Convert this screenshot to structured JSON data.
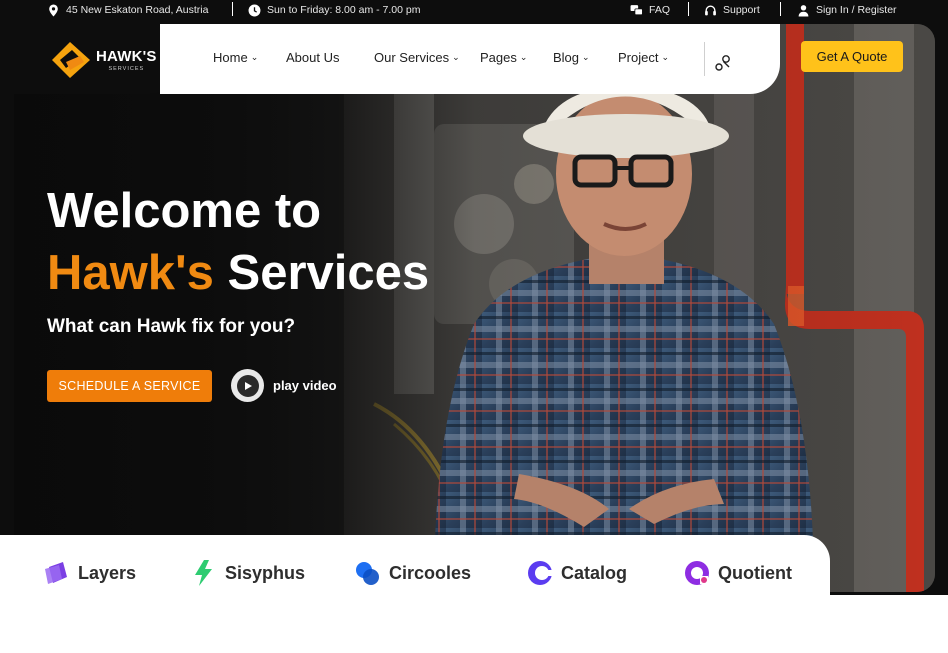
{
  "topbar": {
    "address": "45 New Eskaton Road, Austria",
    "hours": "Sun to Friday: 8.00 am - 7.00 pm",
    "faq": "FAQ",
    "support": "Support",
    "signin": "Sign In / Register"
  },
  "logo": {
    "name": "HAWK'S",
    "tagline": "SERVICES"
  },
  "nav": {
    "items": [
      {
        "label": "Home",
        "has_dropdown": true
      },
      {
        "label": "About Us",
        "has_dropdown": false
      },
      {
        "label": "Our Services",
        "has_dropdown": true
      },
      {
        "label": "Pages",
        "has_dropdown": true
      },
      {
        "label": "Blog",
        "has_dropdown": true
      },
      {
        "label": "Project",
        "has_dropdown": true
      }
    ],
    "chevron": "⌄",
    "quote_label": "Get A Quote"
  },
  "hero": {
    "line1": "Welcome to",
    "line2_accent": "Hawk's",
    "line2_rest": "Services",
    "subtitle": "What can Hawk fix for you?",
    "cta_label": "SCHEDULE A SERVICE",
    "play_label": "play video"
  },
  "brands": [
    {
      "name": "Layers",
      "icon": "layers-icon",
      "color": "#7b3fe4"
    },
    {
      "name": "Sisyphus",
      "icon": "bolt-icon",
      "color": "#2ecc71"
    },
    {
      "name": "Circooles",
      "icon": "circles-icon",
      "color": "#1e6ff2"
    },
    {
      "name": "Catalog",
      "icon": "catalog-icon",
      "color": "#5b3cf0"
    },
    {
      "name": "Quotient",
      "icon": "quotient-icon",
      "color": "#8e2de2"
    }
  ],
  "colors": {
    "accent_orange": "#f08a12",
    "cta_orange": "#ef7d0a",
    "quote_yellow": "#ffc21a",
    "dark": "#0d0d0d"
  }
}
